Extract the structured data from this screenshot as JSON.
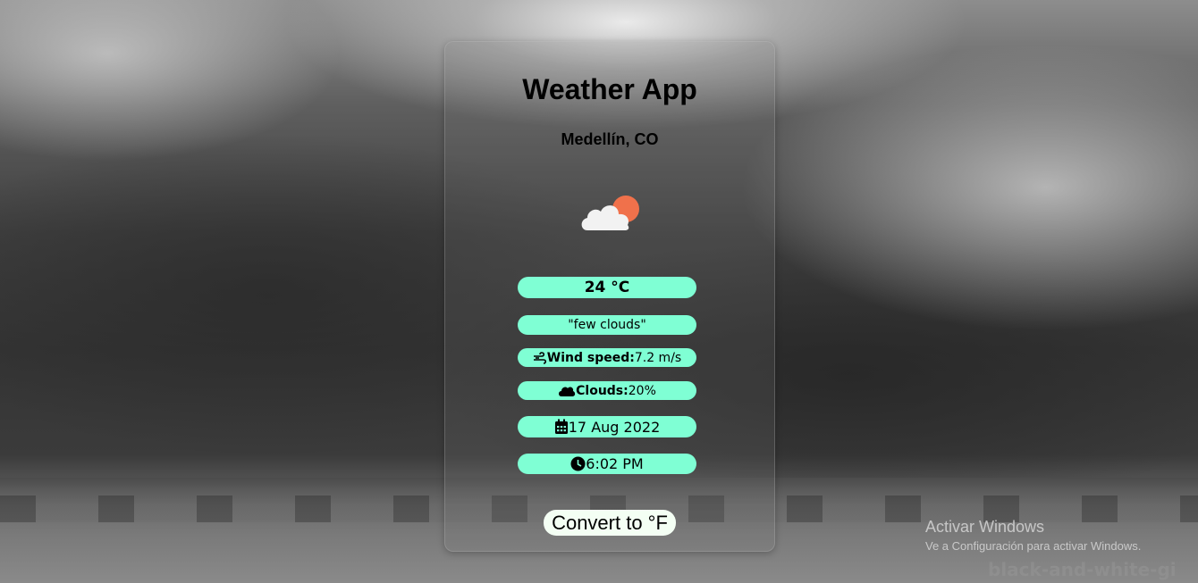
{
  "app": {
    "title": "Weather App",
    "location": "Medellín, CO"
  },
  "weather": {
    "icon": "few-clouds-day-icon",
    "temperature": "24 °C",
    "description": "\"few clouds\"",
    "wind_label": "Wind speed:",
    "wind_value": "7.2 m/s",
    "wind_icon": "wind-icon",
    "clouds_label": "Clouds:",
    "clouds_value": "20%",
    "clouds_icon": "cloud-icon",
    "date": "17 Aug 2022",
    "date_icon": "calendar-icon",
    "time": "6:02 PM",
    "time_icon": "clock-icon"
  },
  "actions": {
    "convert_label": "Convert to °F"
  },
  "watermark": {
    "title": "Activar Windows",
    "subtitle": "Ve a Configuración para activar Windows."
  },
  "background": {
    "caption": "black-and-white-gi"
  },
  "colors": {
    "pill": "#7fffd4",
    "button": "#f4fff4",
    "sun": "#f0714b",
    "cloud": "#f2f2f2"
  }
}
